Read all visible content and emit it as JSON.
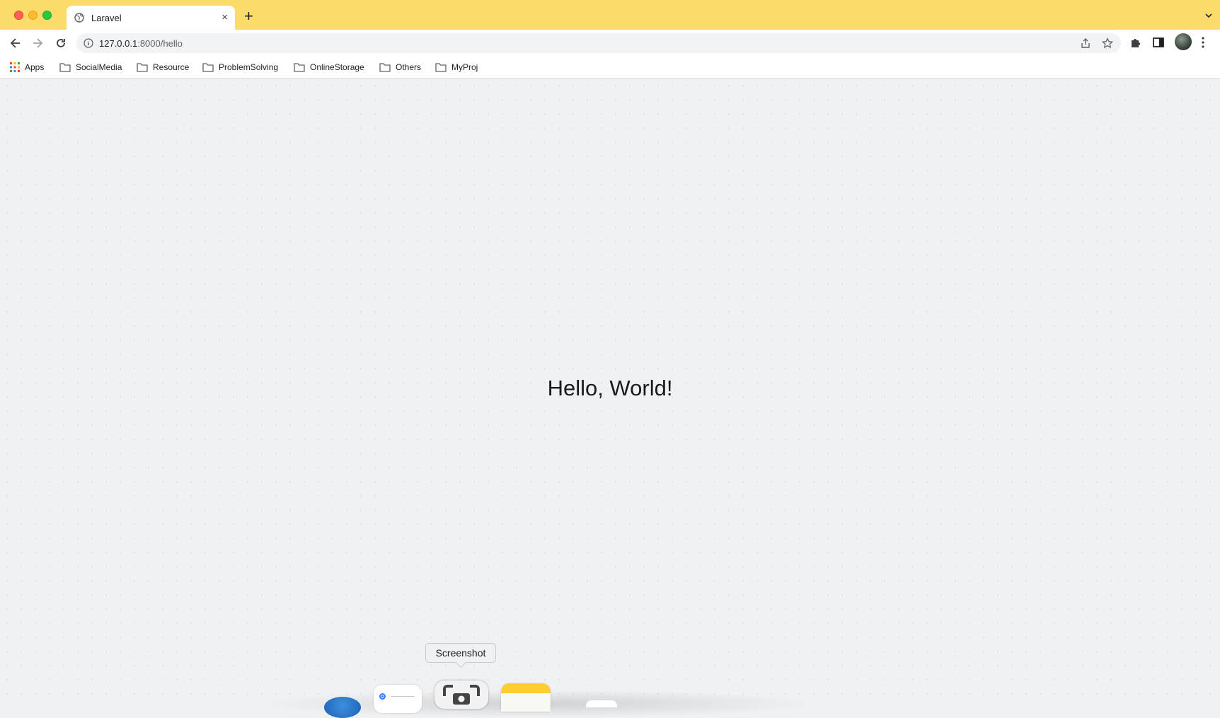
{
  "window": {
    "tab": {
      "title": "Laravel",
      "close_glyph": "×"
    },
    "new_tab_glyph": "+"
  },
  "toolbar": {
    "url_host": "127.0.0.1",
    "url_path": ":8000/hello"
  },
  "bookmarks": [
    {
      "label": "Apps",
      "icon": "apps-grid-icon"
    },
    {
      "label": "SocialMedia",
      "icon": "folder-icon"
    },
    {
      "label": "Resource",
      "icon": "folder-icon"
    },
    {
      "label": "ProblemSolving",
      "icon": "folder-icon"
    },
    {
      "label": "OnlineStorage",
      "icon": "folder-icon"
    },
    {
      "label": "Others",
      "icon": "folder-icon"
    },
    {
      "label": "MyProj",
      "icon": "folder-icon"
    }
  ],
  "page": {
    "heading": "Hello, World!"
  },
  "dock": {
    "tooltip": "Screenshot"
  },
  "colors": {
    "tab_bar": "#fcdc68",
    "page_background": "#f0f1f3"
  }
}
